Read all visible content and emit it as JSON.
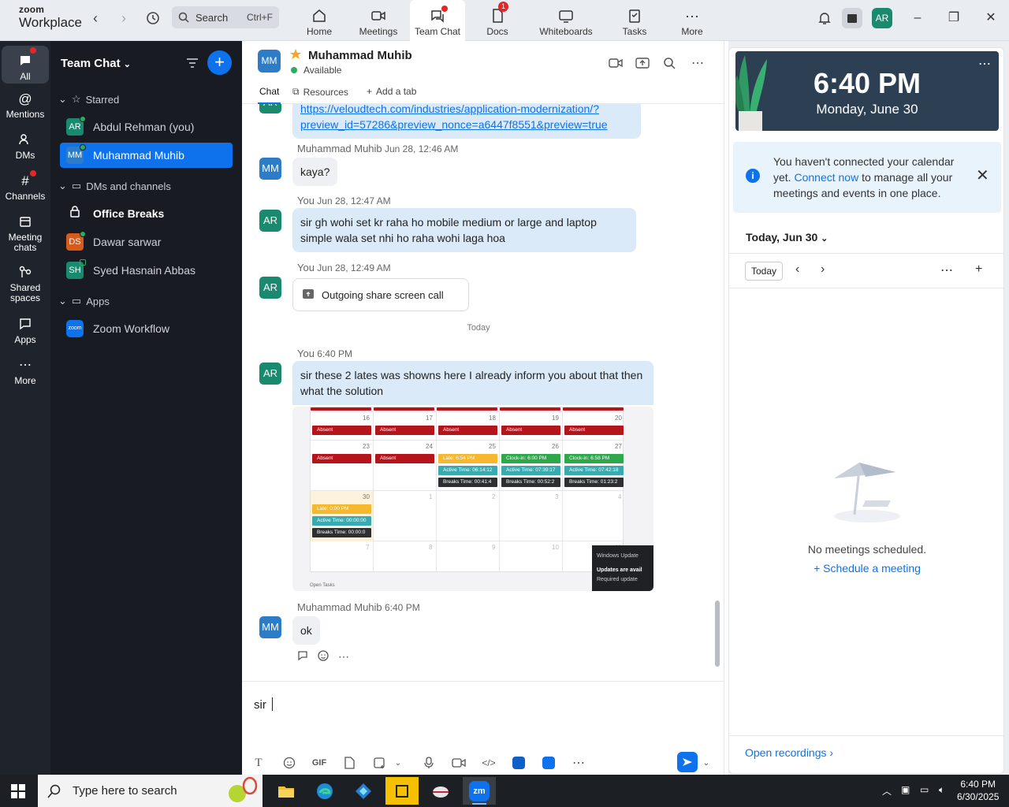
{
  "brand": {
    "line1": "zoom",
    "line2": "Workplace"
  },
  "search": {
    "label": "Search",
    "shortcut": "Ctrl+F"
  },
  "nav_tabs": [
    {
      "label": "Home"
    },
    {
      "label": "Meetings"
    },
    {
      "label": "Team Chat"
    },
    {
      "label": "Docs",
      "badge": "1"
    },
    {
      "label": "Whiteboards"
    },
    {
      "label": "Tasks"
    },
    {
      "label": "More"
    }
  ],
  "user_avatar": "AR",
  "rail": [
    {
      "label": "All"
    },
    {
      "label": "Mentions"
    },
    {
      "label": "DMs"
    },
    {
      "label": "Channels"
    },
    {
      "label": "Meeting chats"
    },
    {
      "label": "Shared spaces"
    },
    {
      "label": "Apps"
    },
    {
      "label": "More"
    }
  ],
  "sidebar": {
    "title": "Team Chat",
    "sections": [
      {
        "label": "Starred"
      },
      {
        "label": "DMs and channels"
      },
      {
        "label": "Apps"
      }
    ],
    "items": [
      {
        "initials": "AR",
        "label": "Abdul Rehman (you)",
        "color": "#1a8a6e"
      },
      {
        "initials": "MM",
        "label": "Muhammad Muhib",
        "color": "#2c7cc8"
      },
      {
        "initials": "",
        "label": "Office Breaks",
        "color": ""
      },
      {
        "initials": "DS",
        "label": "Dawar sarwar",
        "color": "#d65b1f"
      },
      {
        "initials": "SH",
        "label": "Syed Hasnain Abbas",
        "color": "#1a8a6e"
      },
      {
        "initials": "zoom",
        "label": "Zoom Workflow",
        "color": "#0e72ed"
      }
    ]
  },
  "chat": {
    "initials": "MM",
    "name": "Muhammad Muhib",
    "status": "Available",
    "tabs": [
      {
        "label": "Chat"
      },
      {
        "label": "Resources"
      },
      {
        "label": "Add a tab"
      }
    ],
    "messages": {
      "link_line1": "https://veloudtech.com/industries/application-modernization/?",
      "link_line2": "preview_id=57286&preview_nonce=a6447f8551&preview=true",
      "m1_sender": "Muhammad Muhib",
      "m1_time": "Jun 28, 12:46 AM",
      "m1_text": "kaya?",
      "m2_sender": "You",
      "m2_time": "Jun 28, 12:47 AM",
      "m2_text": "sir gh wohi set kr raha ho mobile medium or  large and laptop simple wala set nhi ho raha wohi laga hoa",
      "m3_sender": "You",
      "m3_time": "Jun 28, 12:49 AM",
      "m3_text": "Outgoing share screen call",
      "day_sep": "Today",
      "m4_sender": "You",
      "m4_time": "6:40 PM",
      "m4_text": "sir these 2 lates was showns here I already inform you about that then what the solution",
      "m5_sender": "Muhammad Muhib",
      "m5_time": "6:40 PM",
      "m5_text": "ok"
    },
    "composer_text": "sir"
  },
  "screenshot": {
    "week1": [
      "16",
      "17",
      "18",
      "19",
      "20"
    ],
    "week2": [
      "23",
      "24",
      "25",
      "26",
      "27"
    ],
    "week3": [
      "30",
      "1",
      "2",
      "3",
      "4"
    ],
    "week4": [
      "7",
      "8",
      "9",
      "10",
      "11"
    ],
    "absent": "Absent",
    "late_w2": "Late: 6:54 PM",
    "clockin_26": "Clock-in: 6:00 PM",
    "clockin_27": "Clock-in: 6:58 PM",
    "active_25": "Active Time: 06:14:12",
    "active_26": "Active Time: 07:39:17",
    "active_27": "Active Time: 07:42:18",
    "breaks_25": "Breaks Time: 00:41:4",
    "breaks_26": "Breaks Time: 00:52:2",
    "breaks_27": "Breaks Time: 01:23:2",
    "late_30": "Late: 0:00 PM",
    "active_30": "Active Time: 00:00:00",
    "breaks_30": "Breaks Time: 00:00:0",
    "open_tasks": "Open Tasks",
    "toast_title": "Windows Update",
    "toast_line1": "Updates are avail",
    "toast_line2": "Required update"
  },
  "right_panel": {
    "time": "6:40 PM",
    "date": "Monday, June 30",
    "notice_pre": "You haven't connected your calendar yet.",
    "notice_link": "Connect now",
    "notice_post": "to manage all your meetings and events in one place.",
    "today_heading": "Today, Jun 30",
    "today_button": "Today",
    "no_meetings": "No meetings scheduled.",
    "schedule": "Schedule a meeting",
    "open_recordings": "Open recordings"
  },
  "taskbar": {
    "search_placeholder": "Type here to search",
    "time": "6:40 PM",
    "date": "6/30/2025"
  }
}
